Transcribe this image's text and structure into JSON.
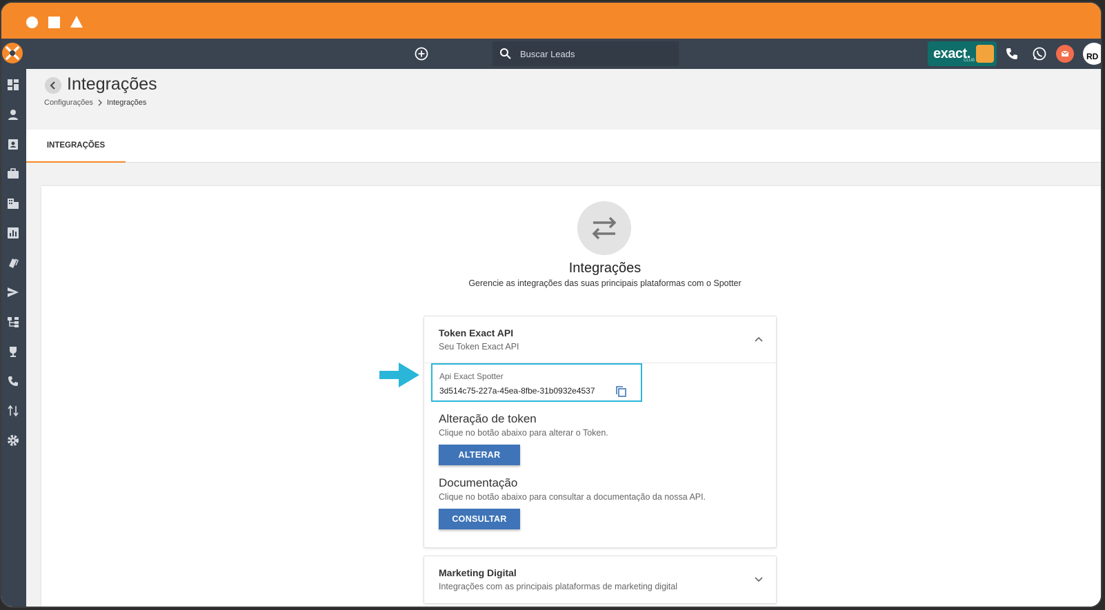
{
  "topnav": {
    "search_placeholder": "Buscar Leads",
    "exact_brand": "exact.",
    "exact_sub": "CLUB",
    "rd_label": "RD"
  },
  "page": {
    "title": "Integrações",
    "breadcrumb": [
      "Configurações",
      "Integrações"
    ]
  },
  "tabs": [
    {
      "label": "INTEGRAÇÕES",
      "active": true
    }
  ],
  "hero": {
    "title": "Integrações",
    "subtitle": "Gerencie as integrações das suas principais plataformas com o Spotter"
  },
  "token_panel": {
    "title": "Token Exact API",
    "subtitle": "Seu Token Exact API",
    "api_label": "Api Exact Spotter",
    "api_value": "3d514c75-227a-45ea-8fbe-31b0932e4537",
    "change_title": "Alteração de token",
    "change_desc": "Clique no botão abaixo para alterar o Token.",
    "change_button": "ALTERAR",
    "doc_title": "Documentação",
    "doc_desc": "Clique no botão abaixo para consultar a documentação da nossa API.",
    "doc_button": "CONSULTAR"
  },
  "marketing_panel": {
    "title": "Marketing Digital",
    "subtitle": "Integrações com as principais plataformas de marketing digital"
  },
  "colors": {
    "titlebar": "#f5892a",
    "nav": "#3a4350",
    "button": "#3f74b8",
    "highlight": "#2ab6d9"
  }
}
